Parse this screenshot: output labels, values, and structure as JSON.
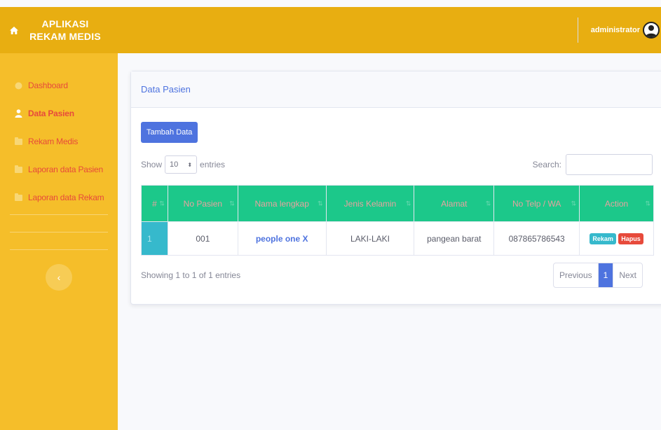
{
  "app": {
    "title": "APLIKASI REKAM MEDIS",
    "user": "administrator"
  },
  "icons": {
    "home": "home-icon",
    "user": "user-avatar-icon",
    "dashboard": "palette-icon",
    "patient": "user-icon",
    "folder": "folder-icon",
    "toggle": "chevron-left-icon"
  },
  "colors": {
    "topbar": "#e8ae11",
    "sidebar": "#f5be2a",
    "primary": "#4e73df",
    "table_header": "#1cc88a",
    "info": "#36b9cc",
    "danger": "#e74a3b"
  },
  "sidebar": {
    "items": [
      {
        "label": "Dashboard",
        "icon": "palette-icon",
        "active": false
      },
      {
        "label": "Data Pasien",
        "icon": "user-icon",
        "active": true
      },
      {
        "label": "Rekam Medis",
        "icon": "folder-icon",
        "active": false
      },
      {
        "label": "Laporan data Pasien",
        "icon": "folder-icon",
        "active": false
      },
      {
        "label": "Laporan data Rekam",
        "icon": "folder-icon",
        "active": false
      }
    ],
    "toggle": "‹"
  },
  "card": {
    "title": "Data Pasien",
    "add_button": "Tambah Data",
    "show_label": "Show",
    "entries_value": "10",
    "entries_label": "entries",
    "search_label": "Search:",
    "search_value": ""
  },
  "table": {
    "headers": [
      "#",
      "No Pasien",
      "Nama lengkap",
      "Jenis Kelamin",
      "Alamat",
      "No Telp / WA",
      "Action"
    ],
    "rows": [
      {
        "idx": "1",
        "no_pasien": "001",
        "nama": "people one X",
        "jenis_kelamin": "LAKI-LAKI",
        "alamat": "pangean barat",
        "telp": "087865786543",
        "actions": [
          "Rekam",
          "Hapus"
        ]
      }
    ]
  },
  "footer": {
    "info": "Showing 1 to 1 of 1 entries",
    "previous": "Previous",
    "current_page": "1",
    "next": "Next"
  }
}
